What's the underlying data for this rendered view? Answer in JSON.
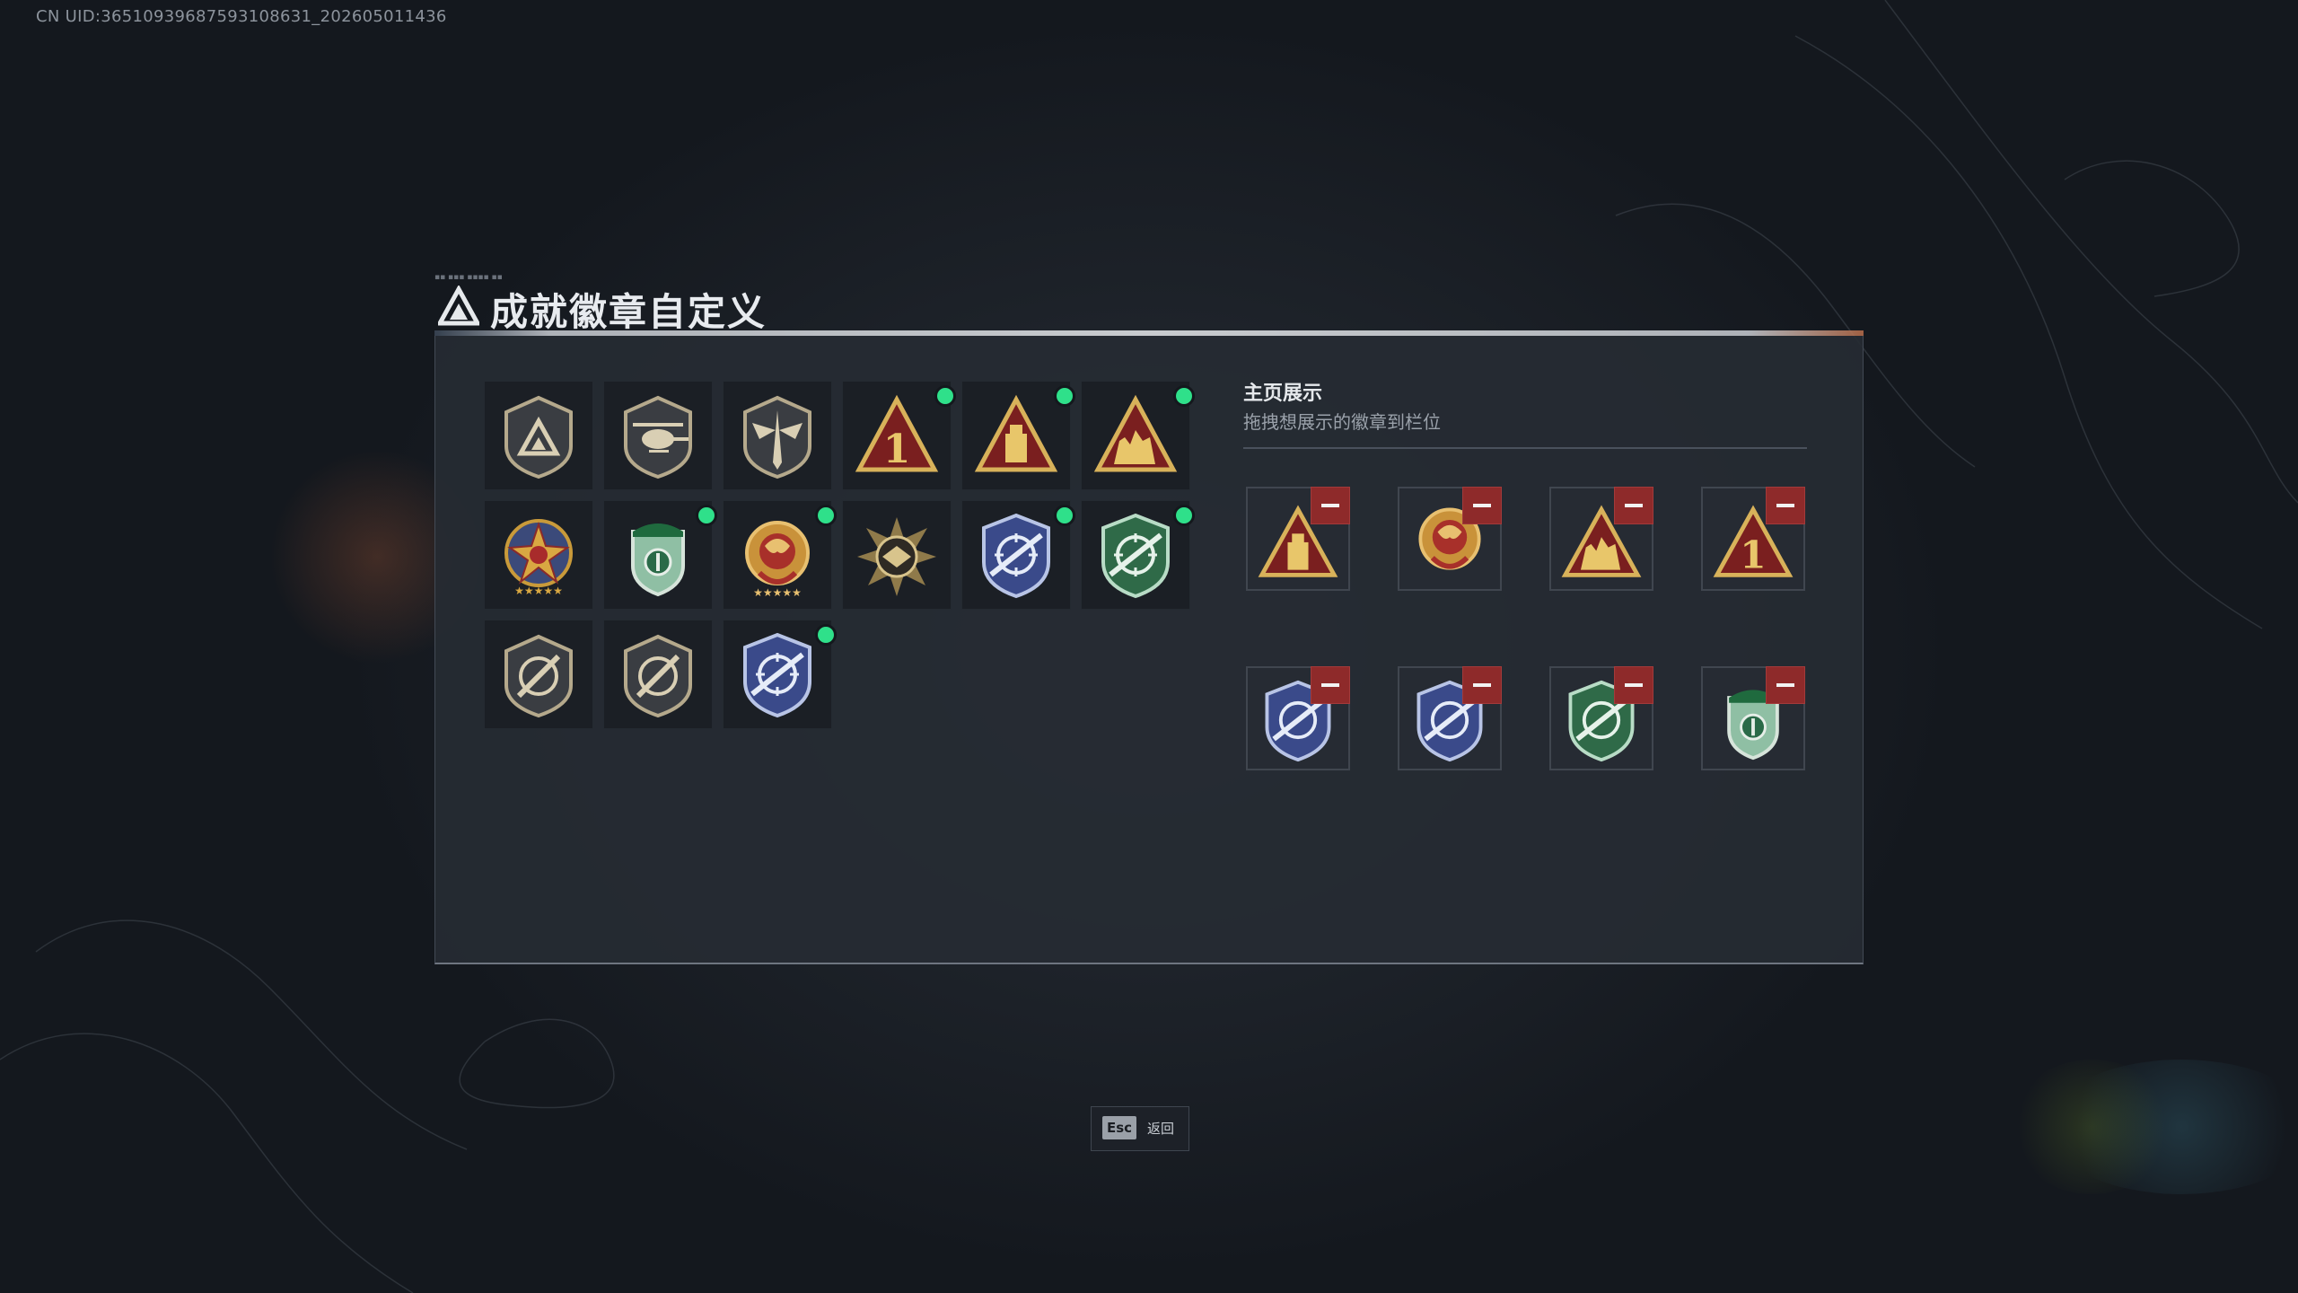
{
  "uid_text": "CN UID:3651093968759310863­1_202605011436",
  "header": {
    "title": "成就徽章自定义"
  },
  "colors": {
    "new_indicator": "#2fe08a",
    "remove_button": "#8e2a2a",
    "panel": "#262b33"
  },
  "badges": [
    {
      "icon": "delta-shield-badge-icon",
      "new": false
    },
    {
      "icon": "helicopter-shield-badge-icon",
      "new": false
    },
    {
      "icon": "winged-dagger-shield-badge-icon",
      "new": false
    },
    {
      "icon": "triangle-number-one-badge-icon",
      "new": true
    },
    {
      "icon": "triangle-tower-badge-icon",
      "new": true
    },
    {
      "icon": "triangle-soldiers-badge-icon",
      "new": true
    },
    {
      "icon": "star-medal-badge-icon",
      "new": false
    },
    {
      "icon": "green-beret-shield-badge-icon",
      "new": true
    },
    {
      "icon": "gold-dragon-medal-badge-icon",
      "new": true
    },
    {
      "icon": "sunburst-emblem-badge-icon",
      "new": false
    },
    {
      "icon": "blue-rifle-crosshair-badge-icon",
      "new": true
    },
    {
      "icon": "green-rifle-crosshair-badge-icon",
      "new": true
    },
    {
      "icon": "rifle-shield-badge-icon",
      "new": false
    },
    {
      "icon": "rifle-shield-badge-icon-2",
      "new": false
    },
    {
      "icon": "blue-rifle-crosshair-badge-icon-2",
      "new": true
    }
  ],
  "showcase": {
    "title": "主页展示",
    "subtitle": "拖拽想展示的徽章到栏位",
    "slots": [
      {
        "icon": "triangle-tower-badge-icon"
      },
      {
        "icon": "gold-dragon-medal-badge-icon"
      },
      {
        "icon": "triangle-soldiers-badge-icon"
      },
      {
        "icon": "triangle-number-one-badge-icon"
      },
      {
        "icon": "blue-rifle-crosshair-badge-icon"
      },
      {
        "icon": "blue-rifle-crosshair-badge-icon-2"
      },
      {
        "icon": "green-rifle-crosshair-badge-icon"
      },
      {
        "icon": "green-beret-shield-badge-icon"
      }
    ]
  },
  "footer": {
    "esc_key": "Esc",
    "esc_label": "返回"
  }
}
